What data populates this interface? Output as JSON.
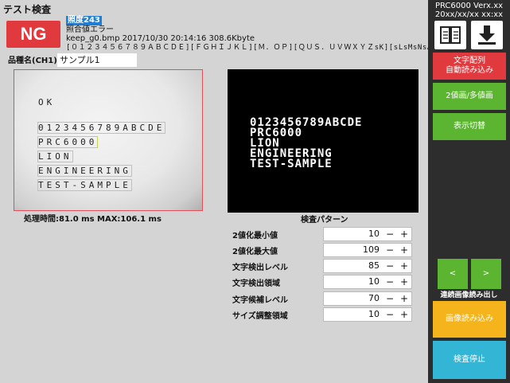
{
  "app": {
    "title": "テスト検査"
  },
  "result": {
    "label": "NG",
    "code": "照度243",
    "message": "照合値エラー"
  },
  "file": {
    "info": "keep_g0.bmp 2017/10/30 20:14:16 308.6Kbyte",
    "charset": "[０１２３４５６７８９ＡＢＣＤＥ][ＦＧＨＩＪＫＬ][Ｍ．ＯＰ][ＱＵＳ．ＵＶＷＸＹＺsK][sLsMsNsA …"
  },
  "product": {
    "label": "品種名(CH1)",
    "value": "サンプル1"
  },
  "camera": {
    "lines": [
      "OK",
      "0123456789ABCDE",
      "PRC6000",
      "LION",
      "ENGINEERING",
      "TEST-SAMPLE"
    ]
  },
  "processing": {
    "text": "処理時間:81.0 ms MAX:106.1 ms"
  },
  "pattern": {
    "label": "検査パターン",
    "lines": [
      "0123456789ABCDE",
      "PRC6000",
      "LION",
      "ENGINEERING",
      "TEST-SAMPLE"
    ]
  },
  "params": [
    {
      "label": "2値化最小値",
      "value": "10"
    },
    {
      "label": "2値化最大値",
      "value": "109"
    },
    {
      "label": "文字検出レベル",
      "value": "85"
    },
    {
      "label": "文字検出領域",
      "value": "10"
    },
    {
      "label": "文字候補レベル",
      "value": "70"
    },
    {
      "label": "サイズ調整領域",
      "value": "10"
    }
  ],
  "stepper": {
    "minus": "−",
    "plus": "+"
  },
  "side": {
    "version": "PRC6000 Verx.xx",
    "datetime": "20xx/xx/xx xx:xx",
    "char_read": "文字配列\n自動読み込み",
    "binary": "2値画/多値画",
    "display": "表示切替",
    "prev": "<",
    "next": ">",
    "continuous": "連続画像読み出し",
    "load_image": "画像読み込み",
    "stop": "検査停止"
  },
  "colors": {
    "ng": "#e03a3e",
    "green": "#5cb530",
    "orange": "#f5b41c",
    "cyan": "#33b6d6",
    "panel": "#2d2d2d"
  },
  "icons": {
    "manual": "book-icon",
    "save": "download-icon"
  }
}
